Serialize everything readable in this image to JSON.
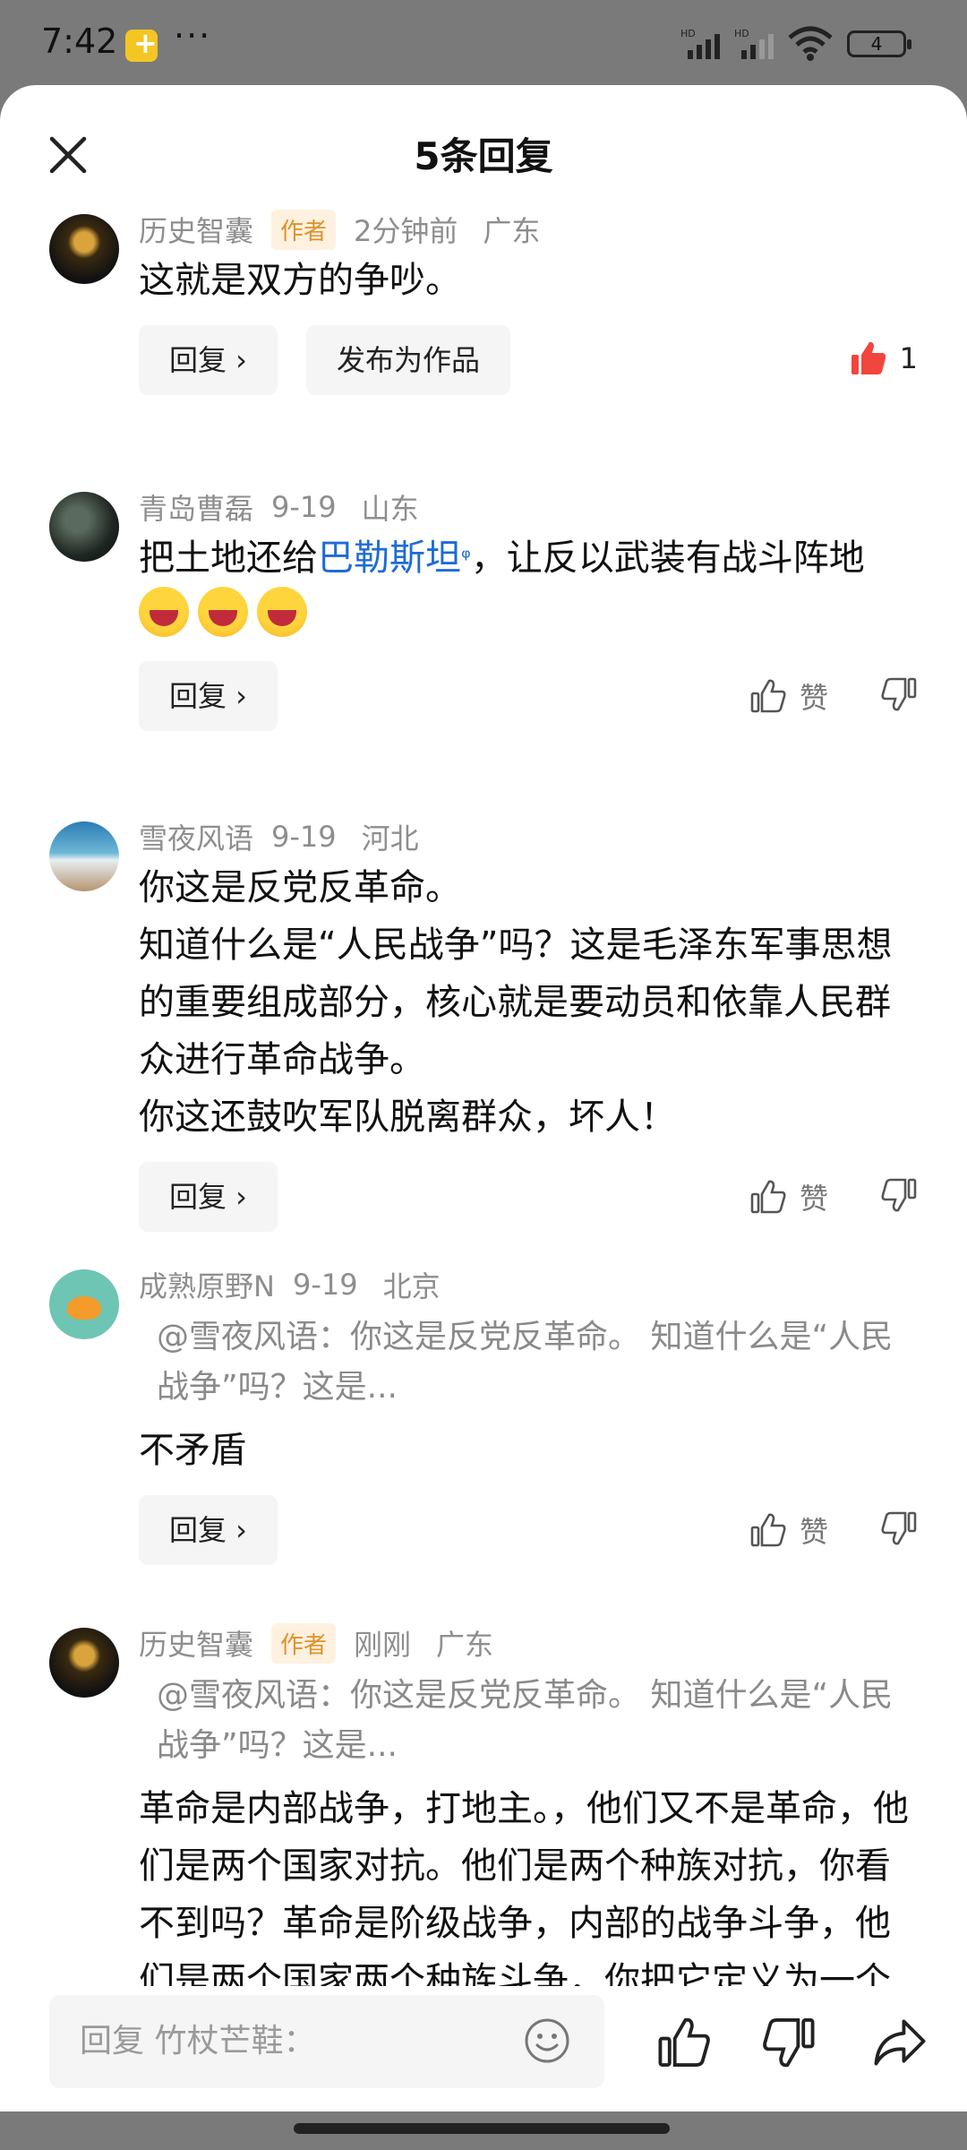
{
  "status_bar": {
    "time": "7:42",
    "more": "···",
    "signal_1": "HD",
    "signal_2": "HD",
    "battery": "4"
  },
  "sheet": {
    "title": "5条回复"
  },
  "comments": [
    {
      "name": "历史智囊",
      "tag": "作者",
      "time": "2分钟前",
      "location": "广东",
      "text": "这就是双方的争吵。",
      "reply_label": "回复 ›",
      "publish_label": "发布为作品",
      "like_count": "1",
      "liked": true
    },
    {
      "name": "青岛曹磊",
      "time": "9-19",
      "location": "山东",
      "text_before": "把土地还给",
      "link": "巴勒斯坦",
      "link_icon": "ᵠ",
      "text_after": "，让反以武装有战斗阵地",
      "reply_label": "回复 ›",
      "like_label": "赞"
    },
    {
      "name": "雪夜风语",
      "time": "9-19",
      "location": "河北",
      "lines": [
        "你这是反党反革命。",
        "知道什么是“人民战争”吗？这是毛泽东军事思想的重要组成部分，核心就是要动员和依靠人民群众进行革命战争。",
        "你这还鼓吹军队脱离群众，坏人！"
      ],
      "reply_label": "回复 ›",
      "like_label": "赞"
    },
    {
      "name": "成熟原野N",
      "time": "9-19",
      "location": "北京",
      "quote": "@雪夜风语：你这是反党反革命。 知道什么是“人民战争”吗？这是...",
      "text": "不矛盾",
      "reply_label": "回复 ›",
      "like_label": "赞"
    },
    {
      "name": "历史智囊",
      "tag": "作者",
      "time": "刚刚",
      "location": "广东",
      "quote": "@雪夜风语：你这是反党反革命。 知道什么是“人民战争”吗？这是...",
      "text": "革命是内部战争，打地主。，他们又不是革命，他们是两个国家对抗。他们是两个种族对抗，你看不到吗？革命是阶级战争，内部的战争斗争，他们是两个国家两个种族斗争，你把它定义为一个革命就是完全错误的。"
    }
  ],
  "bottom_bar": {
    "placeholder": "回复 竹杖芒鞋："
  },
  "colors": {
    "like_active": "#f2453d",
    "link": "#1e6bd6",
    "author_tag_bg": "#fff1df",
    "author_tag_text": "#e0912a"
  }
}
